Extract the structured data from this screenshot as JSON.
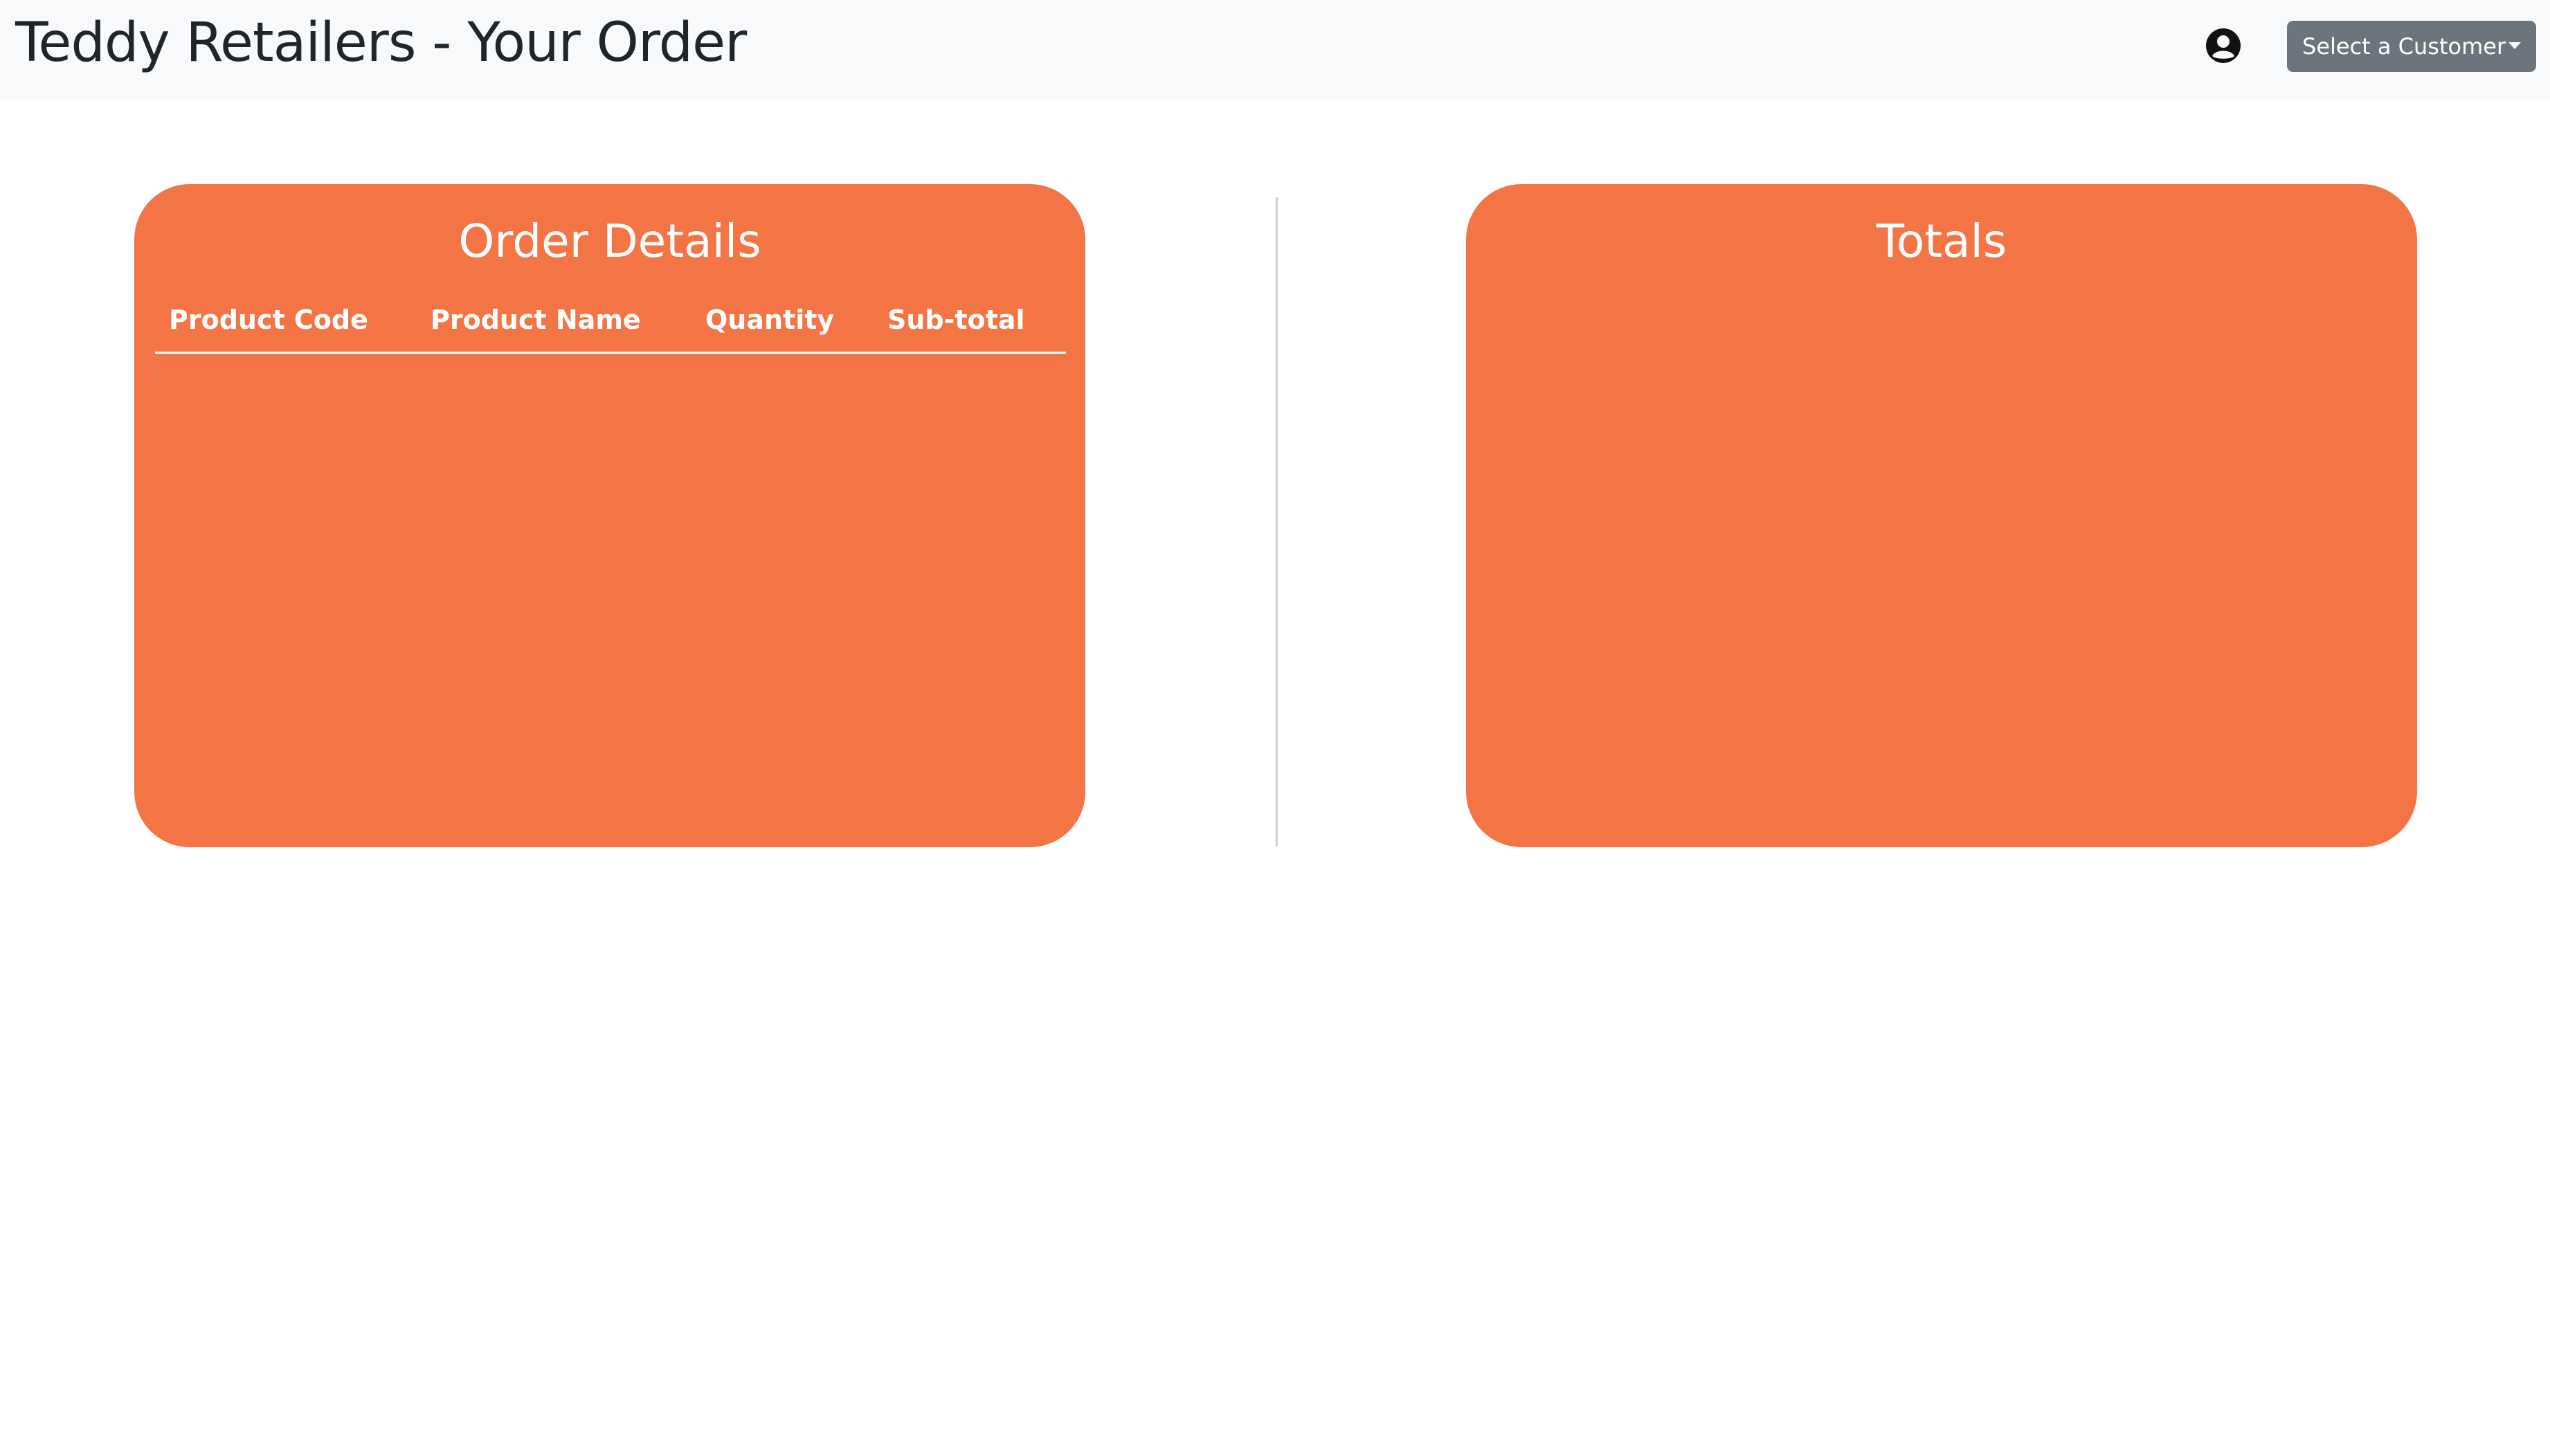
{
  "header": {
    "title": "Teddy Retailers - Your Order",
    "customer_button_label": "Select a Customer"
  },
  "order_details": {
    "title": "Order Details",
    "columns": [
      "Product Code",
      "Product Name",
      "Quantity",
      "Sub-total"
    ],
    "rows": []
  },
  "totals": {
    "title": "Totals"
  },
  "colors": {
    "card_background": "#f37445",
    "navbar_background": "#f8f9fa",
    "button_background": "#6c757d"
  },
  "icons": {
    "user": "user-circle-icon",
    "dropdown": "caret-down-icon"
  }
}
